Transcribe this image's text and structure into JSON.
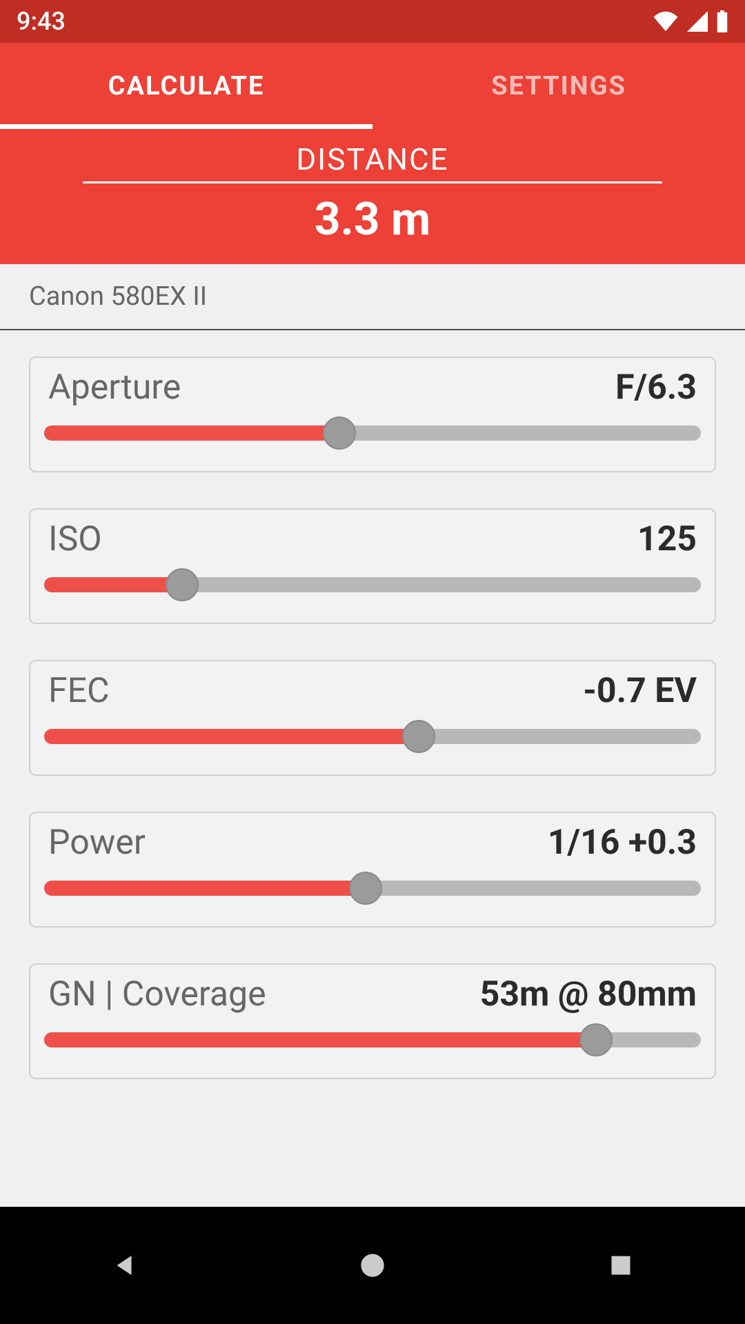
{
  "status": {
    "time": "9:43"
  },
  "tabs": {
    "calculate": "CALCULATE",
    "settings": "SETTINGS"
  },
  "distance": {
    "label": "DISTANCE",
    "value": "3.3 m"
  },
  "device": {
    "name": "Canon 580EX II"
  },
  "sliders": {
    "aperture": {
      "label": "Aperture",
      "value": "F/6.3",
      "percent": 45
    },
    "iso": {
      "label": "ISO",
      "value": "125",
      "percent": 21
    },
    "fec": {
      "label": "FEC",
      "value": "-0.7 EV",
      "percent": 57
    },
    "power": {
      "label": "Power",
      "value": "1/16 +0.3",
      "percent": 49
    },
    "gn": {
      "label": "GN | Coverage",
      "value": "53m @ 80mm",
      "percent": 84
    }
  }
}
